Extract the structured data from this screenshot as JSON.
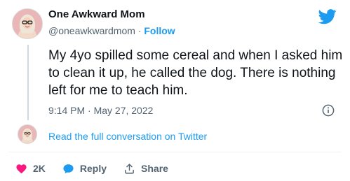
{
  "author": {
    "name": "One Awkward Mom",
    "handle": "@oneawkwardmom",
    "separator": "·",
    "follow_label": "Follow"
  },
  "tweet": {
    "text": "My 4yo spilled some cereal and when I asked him to clean it up, he called the dog. There is nothing left for me to teach him.",
    "timestamp": "9:14 PM · May 27, 2022"
  },
  "conversation": {
    "link_label": "Read the full conversation on Twitter"
  },
  "actions": {
    "like_count": "2K",
    "reply_label": "Reply",
    "share_label": "Share"
  },
  "icons": {
    "brand": "twitter-bird-icon",
    "info": "info-icon",
    "like": "heart-icon",
    "reply": "speech-bubble-icon",
    "share": "share-icon"
  },
  "colors": {
    "brand_blue": "#1d9bf0",
    "like_red": "#f91880",
    "text_secondary": "#536471",
    "text_primary": "#0f1419"
  }
}
